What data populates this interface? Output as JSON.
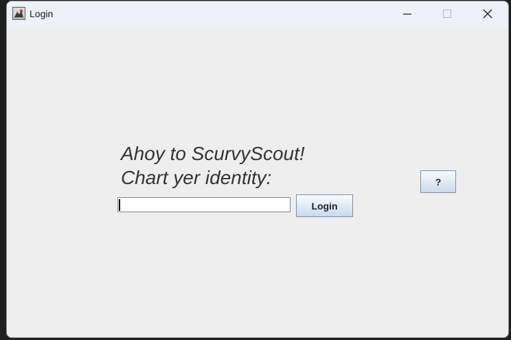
{
  "window": {
    "title": "Login"
  },
  "main": {
    "heading_line1": "Ahoy to ScurvyScout!",
    "heading_line2": "Chart yer identity:",
    "name_input": {
      "value": "",
      "placeholder": ""
    },
    "login_label": "Login",
    "help_label": "?"
  },
  "colors": {
    "content_bg": "#eeeeee",
    "titlebar_bg": "#eef2f8",
    "text": "#333333",
    "button_border": "#7a8ea8"
  },
  "icons": {
    "app": "app-icon",
    "minimize": "minimize-icon",
    "maximize": "maximize-icon",
    "close": "close-icon"
  }
}
